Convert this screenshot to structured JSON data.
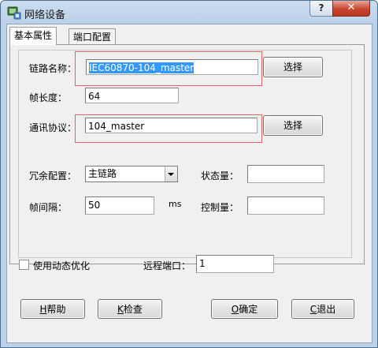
{
  "window": {
    "title": "网络设备",
    "help_label": "?",
    "close_label": "✕"
  },
  "tabs": [
    {
      "label": "基本属性"
    },
    {
      "label": "端口配置"
    }
  ],
  "form": {
    "link_name_label": "链路名称：",
    "link_name_value": "IEC60870-104_master",
    "frame_length_label": "帧长度：",
    "frame_length_value": "64",
    "protocol_label": "通讯协议：",
    "protocol_value": "104_master",
    "select_button_label": "选择",
    "redundancy_label": "冗余配置：",
    "redundancy_value": "主链路",
    "frame_interval_label": "帧间隔：",
    "frame_interval_value": "50",
    "frame_interval_unit": "ms",
    "status_label": "状态量：",
    "status_value": "",
    "control_label": "控制量：",
    "control_value": ""
  },
  "options": {
    "dynamic_opt_label": "使用动态优化",
    "dynamic_opt_checked": false,
    "remote_port_label": "远程端口：",
    "remote_port_value": "1"
  },
  "buttons": {
    "help_key": "H",
    "help_text": "帮助",
    "check_key": "K",
    "check_text": "检查",
    "ok_key": "O",
    "ok_text": "确定",
    "cancel_key": "C",
    "cancel_text": "退出"
  },
  "colors": {
    "selection": "#3399ff",
    "highlight_box": "#e06666",
    "title_gradient": "#bcd1ea",
    "close_button": "#c9452e"
  },
  "icons": {
    "app": "network-device-icon",
    "dropdown": "chevron-down-icon"
  }
}
